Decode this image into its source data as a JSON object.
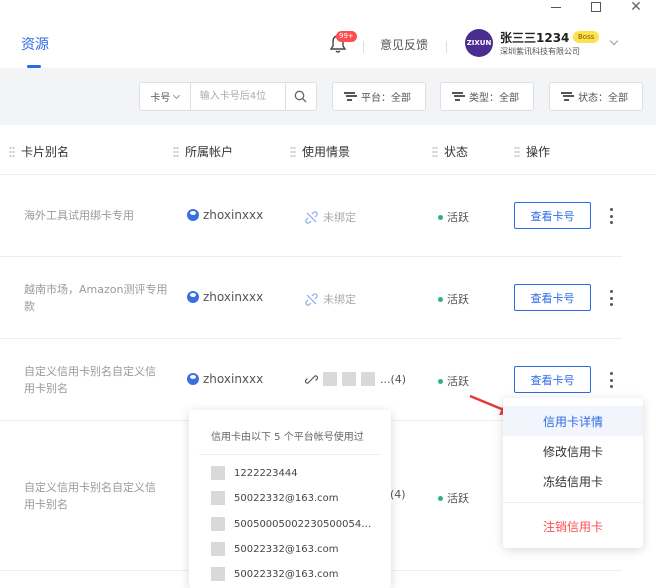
{
  "header": {
    "tab": "资源",
    "notification_badge": "99+",
    "feedback": "意见反馈",
    "avatar_text": "ZIXUN",
    "username": "张三三1234",
    "user_badge": "Boss",
    "company": "深圳紫讯科技有限公司"
  },
  "filters": {
    "search_field": "卡号",
    "search_placeholder": "输入卡号后4位",
    "platform": "平台：全部",
    "type": "类型：全部",
    "status": "状态：全部"
  },
  "table": {
    "columns": [
      "卡片别名",
      "所属帐户",
      "使用情景",
      "状态",
      "操作"
    ],
    "rows": [
      {
        "alias": "海外工具试用绑卡专用",
        "account": "zhoxinxxx",
        "usage": "未绑定",
        "status": "活跃",
        "action": "查看卡号"
      },
      {
        "alias": "越南市场，Amazon测评专用款",
        "account": "zhoxinxxx",
        "usage": "未绑定",
        "status": "活跃",
        "action": "查看卡号"
      },
      {
        "alias": "自定义信用卡别名自定义信用卡别名",
        "account": "zhoxinxxx",
        "usage": "...(4)",
        "status": "活跃",
        "action": "查看卡号"
      },
      {
        "alias": "自定义信用卡别名自定义信用卡别名",
        "account": "",
        "usage": "(4)",
        "status": "活跃",
        "action": ""
      }
    ]
  },
  "popover": {
    "title": "信用卡由以下 5 个平台帐号使用过",
    "items": [
      "1222223444",
      "50022332@163.com",
      "50050005002230500054…",
      "50022332@163.com",
      "50022332@163.com"
    ]
  },
  "menu": {
    "items": [
      "信用卡详情",
      "修改信用卡",
      "冻结信用卡",
      "注销信用卡"
    ]
  },
  "colors": {
    "primary": "#2d6be4",
    "danger": "#ff4d4f",
    "active": "#2bb673"
  }
}
